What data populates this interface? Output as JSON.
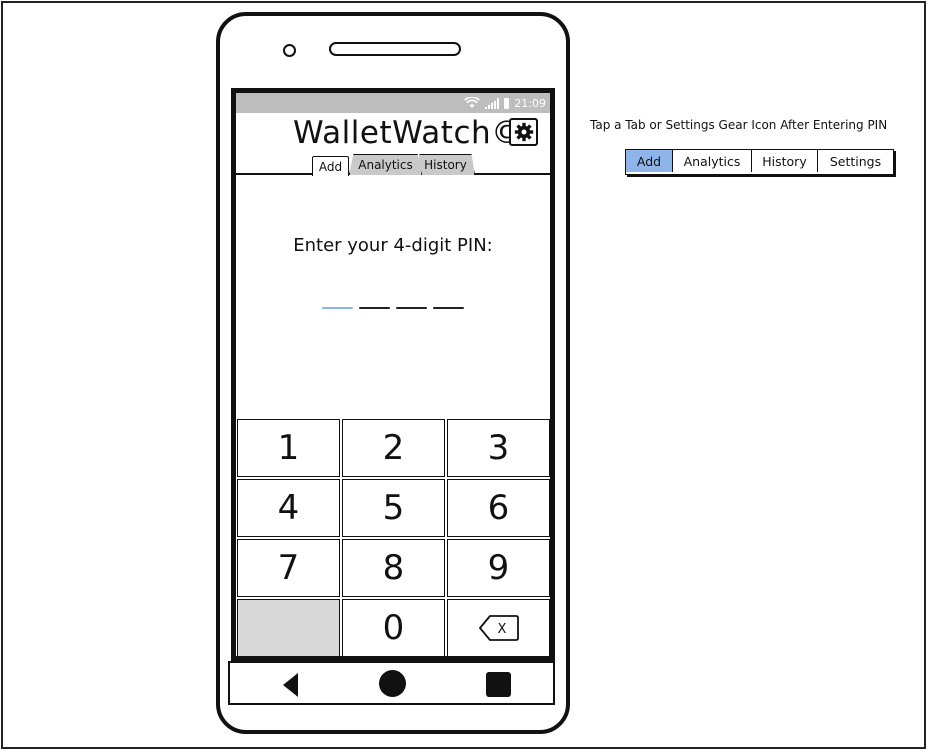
{
  "status_bar": {
    "time": "21:09"
  },
  "app": {
    "title": "WalletWatch©"
  },
  "tabs": [
    {
      "label": "Add",
      "active": true
    },
    {
      "label": "Analytics",
      "active": false
    },
    {
      "label": "History",
      "active": false
    }
  ],
  "pin": {
    "prompt": "Enter your 4-digit PIN:",
    "digits_entered": 0,
    "length": 4
  },
  "keypad": {
    "keys": [
      "1",
      "2",
      "3",
      "4",
      "5",
      "6",
      "7",
      "8",
      "9",
      "",
      "0",
      "X"
    ]
  },
  "annotation": {
    "hint": "Tap a Tab or Settings Gear Icon After Entering PIN",
    "buttons": [
      {
        "label": "Add",
        "selected": true
      },
      {
        "label": "Analytics",
        "selected": false
      },
      {
        "label": "History",
        "selected": false
      },
      {
        "label": "Settings",
        "selected": false
      }
    ]
  },
  "colors": {
    "accent": "#8fb4ea",
    "status_bar": "#bdbdbd",
    "blank_key": "#d9d9d9"
  },
  "icons": {
    "settings": "gear-icon",
    "wifi": "wifi-icon",
    "signal": "signal-icon",
    "battery": "battery-icon",
    "backspace": "backspace-icon",
    "back": "back-triangle-icon",
    "home": "home-circle-icon",
    "recents": "recents-square-icon"
  }
}
